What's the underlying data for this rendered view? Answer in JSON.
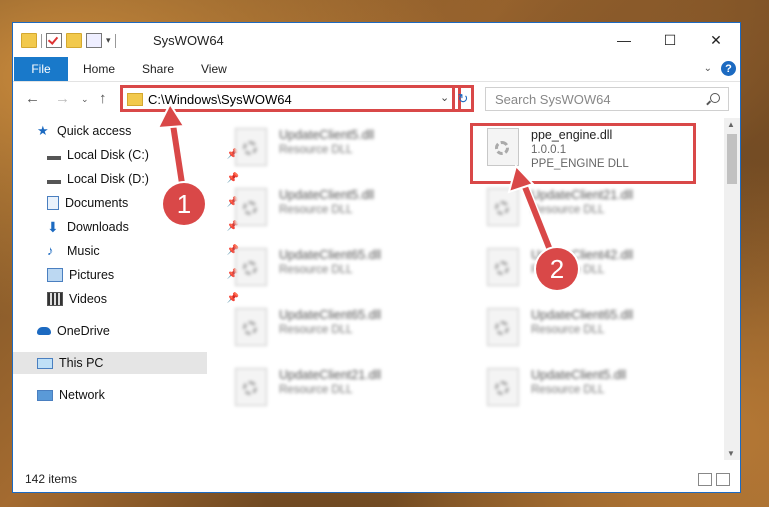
{
  "window": {
    "title": "SysWOW64",
    "minimize": "—",
    "maximize": "☐",
    "close": "✕"
  },
  "ribbon": {
    "tabs": [
      "File",
      "Home",
      "Share",
      "View"
    ],
    "help": "?"
  },
  "nav": {
    "back": "←",
    "forward": "→",
    "up": "↑",
    "address": "C:\\Windows\\SysWOW64",
    "search_placeholder": "Search SysWOW64"
  },
  "sidebar": {
    "items": [
      {
        "label": "Quick access",
        "icon": "star-icon"
      },
      {
        "label": "Local Disk (C:)",
        "icon": "drive-icon"
      },
      {
        "label": "Local Disk (D:)",
        "icon": "drive-icon"
      },
      {
        "label": "Documents",
        "icon": "documents-icon"
      },
      {
        "label": "Downloads",
        "icon": "download-icon"
      },
      {
        "label": "Music",
        "icon": "music-icon"
      },
      {
        "label": "Pictures",
        "icon": "pictures-icon"
      },
      {
        "label": "Videos",
        "icon": "videos-icon"
      },
      {
        "label": "OneDrive",
        "icon": "cloud-icon"
      },
      {
        "label": "This PC",
        "icon": "computer-icon"
      },
      {
        "label": "Network",
        "icon": "network-icon"
      }
    ]
  },
  "files": {
    "highlighted": {
      "name": "ppe_engine.dll",
      "version": "1.0.0.1",
      "desc": "PPE_ENGINE DLL"
    },
    "col1": [
      {
        "name": "UpdateClient5.dll",
        "desc": "Resource DLL"
      },
      {
        "name": "UpdateClient5.dll",
        "desc": "Resource DLL"
      },
      {
        "name": "UpdateClient65.dll",
        "desc": "Resource DLL"
      },
      {
        "name": "UpdateClient65.dll",
        "desc": "Resource DLL"
      },
      {
        "name": "UpdateClient21.dll",
        "desc": "Resource DLL"
      }
    ],
    "col2": [
      {
        "name": "UpdateClient21.dll",
        "desc": "Resource DLL"
      },
      {
        "name": "UpdateClient42.dll",
        "desc": "Resource DLL"
      },
      {
        "name": "UpdateClient65.dll",
        "desc": "Resource DLL"
      },
      {
        "name": "UpdateClient5.dll",
        "desc": "Resource DLL"
      }
    ]
  },
  "status": {
    "count": "142 items"
  },
  "annotations": {
    "step1": "1",
    "step2": "2"
  },
  "colors": {
    "accent": "#1979ca",
    "highlight": "#d94848"
  }
}
